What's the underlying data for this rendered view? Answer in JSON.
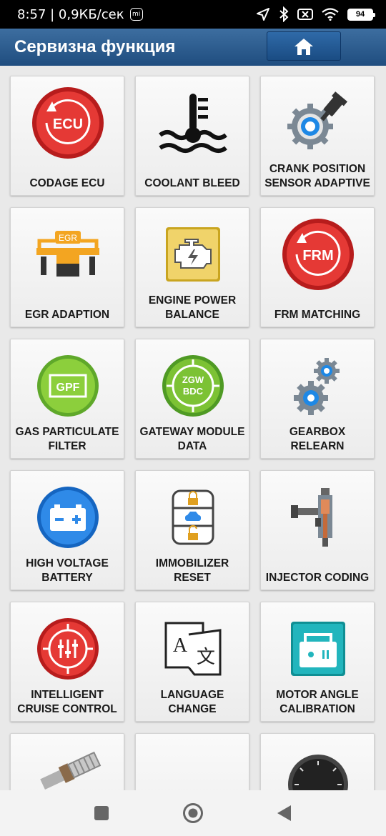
{
  "status": {
    "time_speed": "8:57 | 0,9КБ/сек",
    "mi_badge": "mi",
    "battery": "94"
  },
  "appbar": {
    "title": "Сервизна функция"
  },
  "tiles": [
    {
      "label": "CODAGE ECU",
      "badge": "ECU",
      "icon": "ecu-reset-icon"
    },
    {
      "label": "COOLANT BLEED",
      "icon": "coolant-temperature-icon"
    },
    {
      "label": "CRANK POSITION SENSOR ADAPTIVE",
      "icon": "crank-sensor-gear-icon"
    },
    {
      "label": "EGR ADAPTION",
      "badge": "EGR",
      "icon": "egr-valve-icon"
    },
    {
      "label": "ENGINE POWER BALANCE",
      "icon": "engine-warning-icon"
    },
    {
      "label": "FRM MATCHING",
      "badge": "FRM",
      "icon": "frm-reset-icon"
    },
    {
      "label": "GAS PARTICULATE FILTER",
      "badge": "GPF",
      "icon": "gpf-filter-icon"
    },
    {
      "label": "GATEWAY MODULE DATA",
      "badge": "ZGW",
      "badge2": "BDC",
      "icon": "gateway-module-icon"
    },
    {
      "label": "GEARBOX RELEARN",
      "icon": "gears-icon"
    },
    {
      "label": "HIGH VOLTAGE BATTERY",
      "icon": "battery-icon"
    },
    {
      "label": "IMMOBILIZER RESET",
      "icon": "immobilizer-lock-icon"
    },
    {
      "label": "INJECTOR CODING",
      "icon": "injector-icon"
    },
    {
      "label": "INTELLIGENT CRUISE CONTROL",
      "icon": "cruise-control-icon"
    },
    {
      "label": "LANGUAGE CHANGE",
      "badge": "A",
      "badge2": "文",
      "icon": "language-translate-icon"
    },
    {
      "label": "MOTOR ANGLE CALIBRATION",
      "icon": "motor-calibration-icon"
    },
    {
      "label": "",
      "icon": "oxygen-sensor-icon"
    },
    {
      "label": "",
      "icon": "blank-icon"
    },
    {
      "label": "",
      "icon": "speedometer-icon"
    }
  ]
}
